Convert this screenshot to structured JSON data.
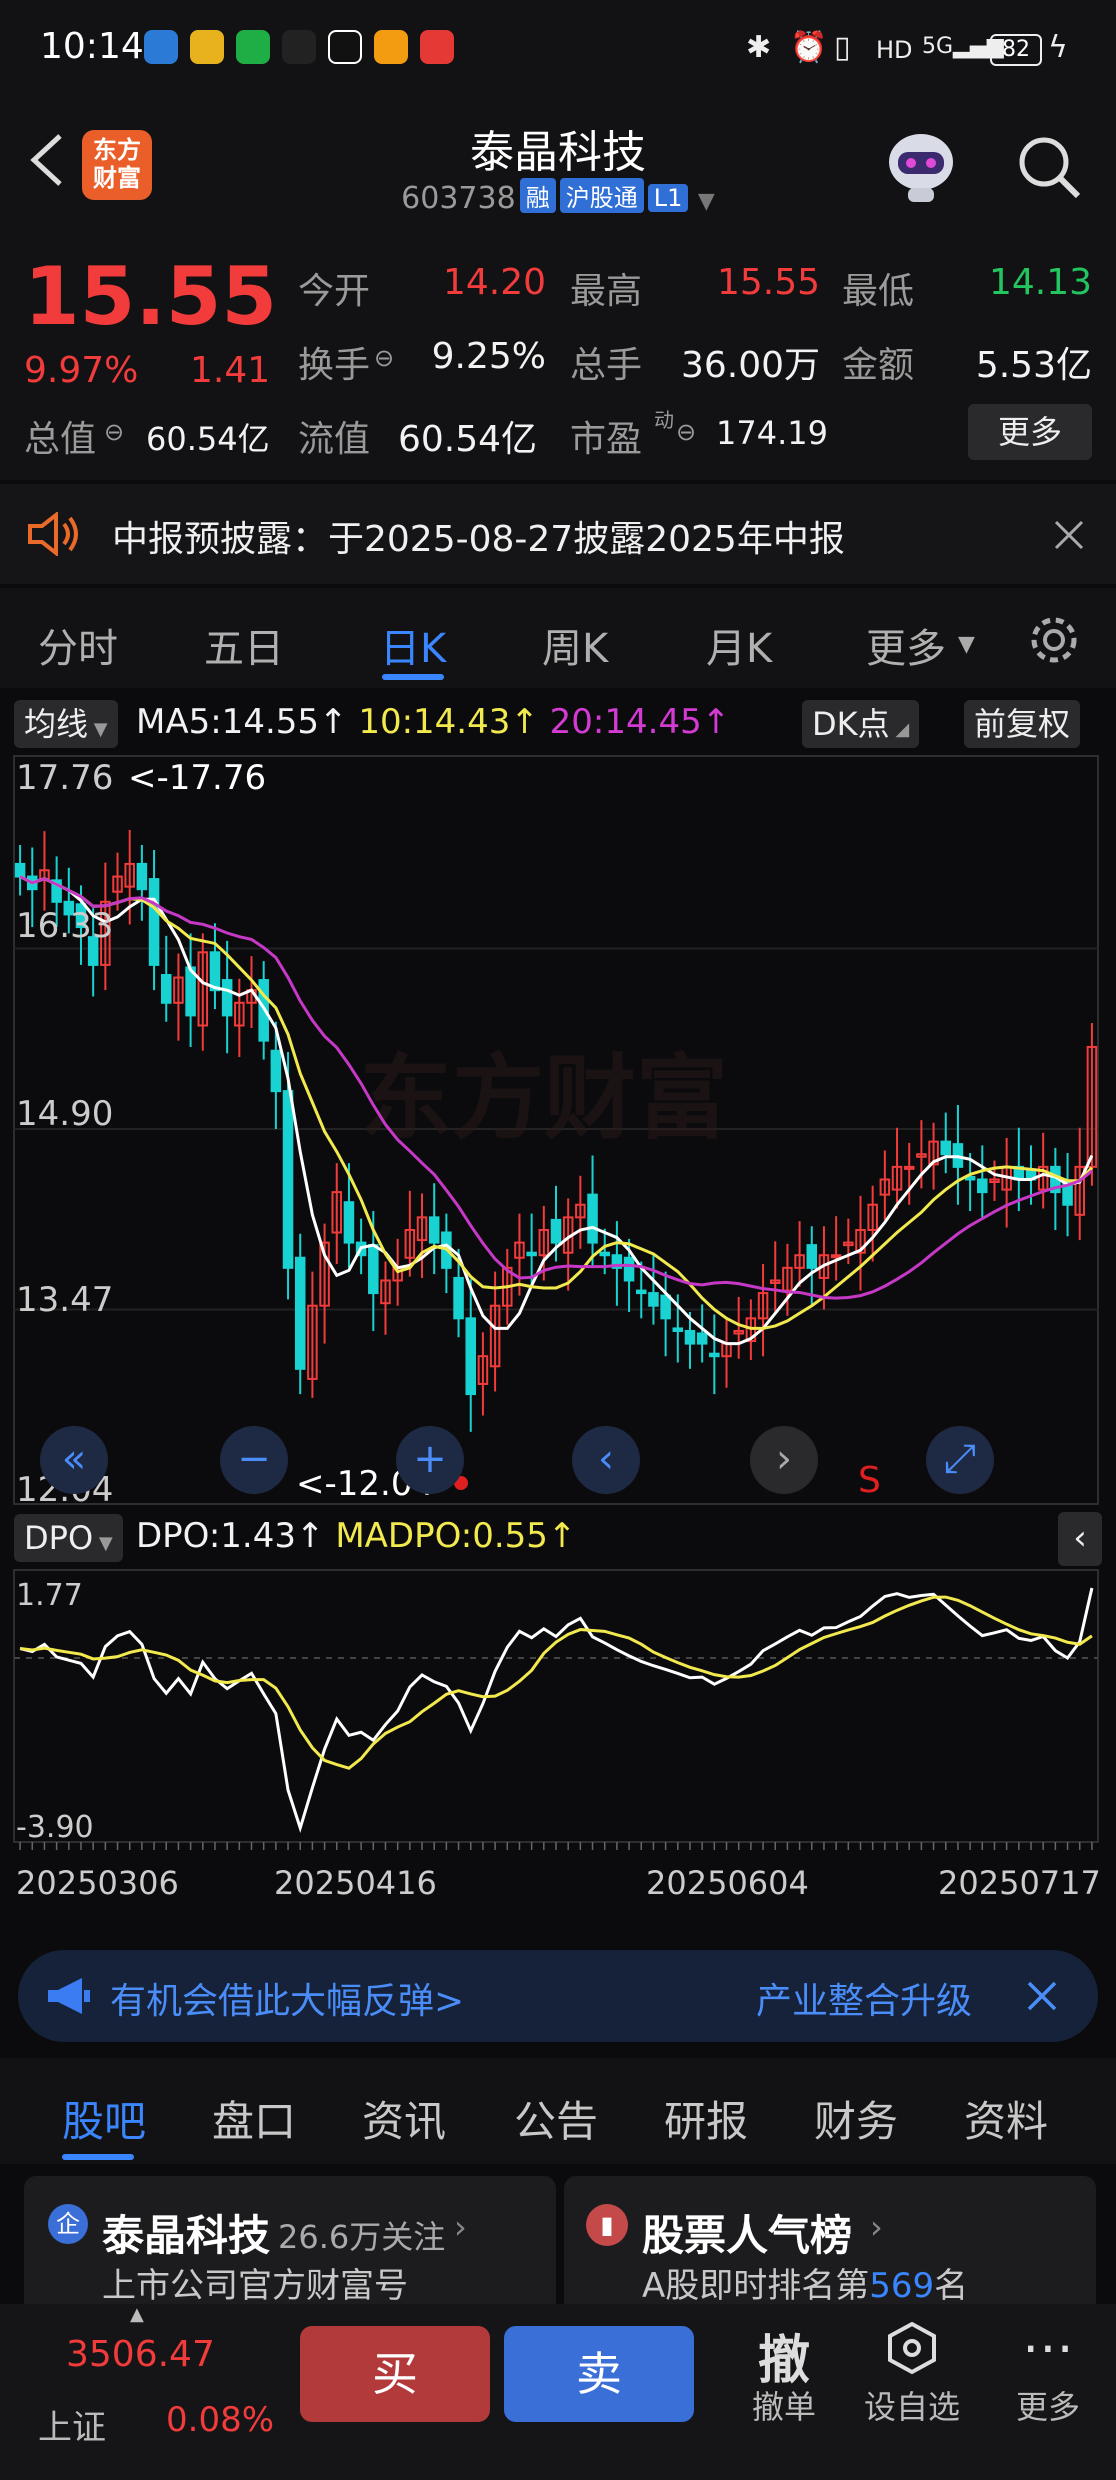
{
  "status": {
    "time": "10:14",
    "battery": "82"
  },
  "header": {
    "title": "泰晶科技",
    "code": "603738",
    "tag1": "融",
    "tag2": "沪股通",
    "tag3": "L1",
    "logo": "东方财富"
  },
  "quote": {
    "price": "15.55",
    "pct": "9.97%",
    "chg": "1.41",
    "open_l": "今开",
    "open_v": "14.20",
    "high_l": "最高",
    "high_v": "15.55",
    "low_l": "最低",
    "low_v": "14.13",
    "turn_l": "换手",
    "turn_v": "9.25%",
    "vol_l": "总手",
    "vol_v": "36.00万",
    "amt_l": "金额",
    "amt_v": "5.53亿",
    "mcap_l": "总值",
    "mcap_v": "60.54亿",
    "float_l": "流值",
    "float_v": "60.54亿",
    "pe_l": "市盈",
    "pe_sup": "动",
    "pe_v": "174.19",
    "more": "更多"
  },
  "notice": {
    "text": "中报预披露：于2025-08-27披露2025年中报"
  },
  "period_tabs": [
    "分时",
    "五日",
    "日K",
    "周K",
    "月K",
    "更多"
  ],
  "chart": {
    "ma_btn": "均线",
    "ma5": "MA5:14.55",
    "ma10": "10:14.43",
    "ma20": "20:14.45",
    "dk_btn": "DK点",
    "adj_btn": "前复权",
    "y_labels": [
      "17.76",
      "16.33",
      "14.90",
      "13.47",
      "12.04"
    ],
    "max_note": "<-17.76",
    "min_note": "<-12.04",
    "watermark": "东方财富",
    "dpo_btn": "DPO",
    "dpo": "DPO:1.43",
    "madpo": "MADPO:0.55",
    "dpo_top": "1.77",
    "dpo_bottom": "-3.90",
    "x_labels": [
      "20250306",
      "20250416",
      "20250604",
      "20250717"
    ],
    "s_mark": "S"
  },
  "chart_data": {
    "type": "candlestick",
    "ylim": [
      12.04,
      17.76
    ],
    "closes": [
      16.9,
      16.8,
      16.95,
      16.7,
      16.6,
      16.5,
      16.2,
      16.7,
      16.9,
      17.0,
      16.8,
      16.2,
      15.9,
      16.1,
      15.8,
      16.3,
      16.0,
      15.8,
      15.9,
      16.0,
      15.6,
      15.2,
      13.8,
      13.0,
      13.5,
      14.0,
      14.4,
      14.0,
      13.9,
      13.6,
      13.7,
      13.8,
      14.1,
      14.2,
      14.0,
      13.8,
      13.4,
      12.8,
      13.1,
      13.5,
      13.8,
      14.0,
      13.9,
      14.1,
      14.0,
      14.2,
      14.3,
      14.0,
      13.9,
      13.8,
      13.7,
      13.6,
      13.5,
      13.4,
      13.3,
      13.2,
      13.2,
      13.1,
      13.2,
      13.3,
      13.4,
      13.6,
      13.7,
      13.8,
      13.9,
      13.8,
      13.9,
      13.9,
      14.0,
      14.1,
      14.3,
      14.5,
      14.6,
      14.6,
      14.7,
      14.8,
      14.7,
      14.6,
      14.5,
      14.4,
      14.5,
      14.6,
      14.5,
      14.5,
      14.6,
      14.4,
      14.3,
      14.6,
      15.55
    ],
    "ma5_last": 14.55,
    "ma10_last": 14.43,
    "ma20_last": 14.45,
    "dpo_last": 1.43,
    "madpo_last": 0.55,
    "x_ticks": [
      "20250306",
      "20250416",
      "20250604",
      "20250717"
    ]
  },
  "banner": {
    "left": "有机会借此大幅反弹>",
    "right": "产业整合升级"
  },
  "bottom_tabs": [
    "股吧",
    "盘口",
    "资讯",
    "公告",
    "研报",
    "财务",
    "资料"
  ],
  "card1": {
    "title": "泰晶科技",
    "follow": "26.6万关注",
    "sub": "上市公司官方财富号"
  },
  "card2": {
    "title": "股票人气榜",
    "sub_pre": "A股即时排名第",
    "rank": "569",
    "sub_post": "名"
  },
  "bottombar": {
    "index_val": "3506.47",
    "index_name": "上证",
    "index_pct": "0.08%",
    "buy": "买",
    "sell": "卖",
    "cancel_icon": "撤",
    "cancel": "撤单",
    "watch": "设自选",
    "more": "更多"
  }
}
